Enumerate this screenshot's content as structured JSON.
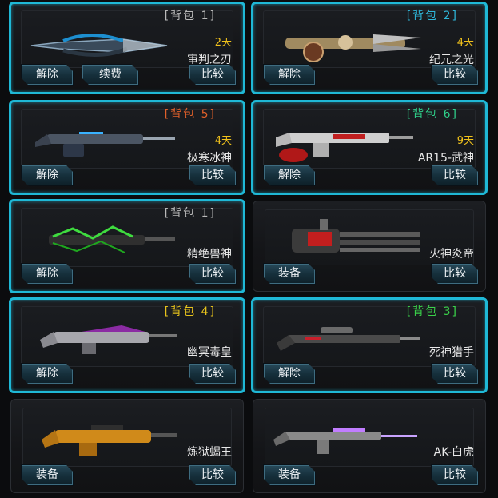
{
  "cards": [
    {
      "bag": "背包 1",
      "bag_color": "#b9b9b9",
      "days": "2天",
      "name": "审判之刃",
      "left_btn": "解除",
      "renew_btn": "续费",
      "compare_btn": "比较",
      "icon": "blade-weapon-icon",
      "equipped": true
    },
    {
      "bag": "背包 2",
      "bag_color": "#2fb6d8",
      "days": "4天",
      "name": "纪元之光",
      "left_btn": "解除",
      "compare_btn": "比较",
      "icon": "crossbow-weapon-icon",
      "equipped": true
    },
    {
      "bag": "背包 5",
      "bag_color": "#e0602a",
      "days": "4天",
      "name": "极寒冰神",
      "left_btn": "解除",
      "compare_btn": "比较",
      "icon": "ice-rifle-icon",
      "equipped": true
    },
    {
      "bag": "背包 6",
      "bag_color": "#2fd08a",
      "days": "9天",
      "name": "AR15-武神",
      "left_btn": "解除",
      "compare_btn": "比较",
      "icon": "ar15-rifle-icon",
      "equipped": true
    },
    {
      "bag": "背包 1",
      "bag_color": "#b9b9b9",
      "name": "精绝兽神",
      "left_btn": "解除",
      "compare_btn": "比较",
      "icon": "beast-rifle-icon",
      "equipped": true
    },
    {
      "name": "火神炎帝",
      "left_btn": "装备",
      "compare_btn": "比较",
      "icon": "minigun-icon",
      "equipped": false
    },
    {
      "bag": "背包 4",
      "bag_color": "#e6c21c",
      "name": "幽冥毒皇",
      "left_btn": "解除",
      "compare_btn": "比较",
      "icon": "venom-rifle-icon",
      "equipped": true
    },
    {
      "bag": "背包 3",
      "bag_color": "#3ad24a",
      "name": "死神猎手",
      "left_btn": "解除",
      "compare_btn": "比较",
      "icon": "sniper-rifle-icon",
      "equipped": true
    },
    {
      "name": "炼狱蝎王",
      "left_btn": "装备",
      "compare_btn": "比较",
      "icon": "scorpion-rifle-icon",
      "equipped": false
    },
    {
      "name": "AK-白虎",
      "left_btn": "装备",
      "compare_btn": "比较",
      "icon": "ak-rifle-icon",
      "equipped": false
    }
  ]
}
